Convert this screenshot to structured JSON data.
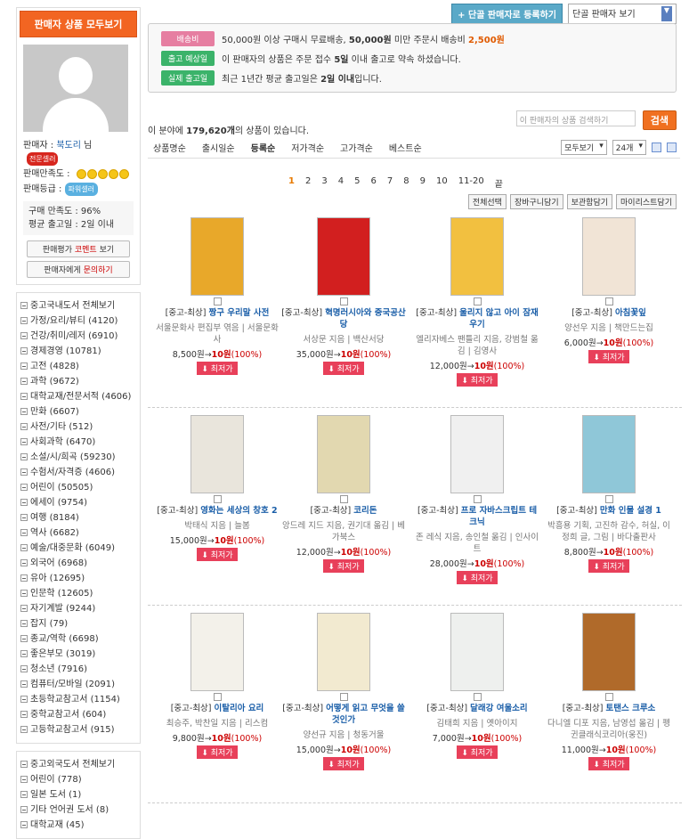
{
  "sidebar": {
    "header": "판매자 상품 모두보기",
    "seller_label": "판매자 :",
    "seller_name": "북도리",
    "seller_suffix": "님",
    "seller_badge": "전문셀러",
    "satisfaction_label": "판매만족도 :",
    "grade_label": "판매등급 :",
    "grade_badge": "파워셀러",
    "buy_satisfaction": "구매 만족도 : 96%",
    "avg_ship": "평균 출고일 : 2일 이내",
    "btn_comment_a": "판매평가",
    "btn_comment_b": "코멘트",
    "btn_comment_c": "보기",
    "btn_inquiry_a": "판매자에게",
    "btn_inquiry_b": "문의하기",
    "domestic_title": "중고국내도서 전체보기",
    "domestic": [
      "가정/요리/뷰티 (4120)",
      "건강/취미/레저 (6910)",
      "경제경영 (10781)",
      "고전 (4828)",
      "과학 (9672)",
      "대학교재/전문서적 (4606)",
      "만화 (6607)",
      "사전/기타 (512)",
      "사회과학 (6470)",
      "소설/시/희곡 (59230)",
      "수험서/자격증 (4606)",
      "어린이 (50505)",
      "에세이 (9754)",
      "여행 (8184)",
      "역사 (6682)",
      "예술/대중문화 (6049)",
      "외국어 (6968)",
      "유아 (12695)",
      "인문학 (12605)",
      "자기계발 (9244)",
      "잡지 (79)",
      "종교/역학 (6698)",
      "좋은부모 (3019)",
      "청소년 (7916)",
      "컴퓨터/모바일 (2091)",
      "초등학교참고서 (1154)",
      "중학교참고서 (604)",
      "고등학교참고서 (915)"
    ],
    "foreign_title": "중고외국도서 전체보기",
    "foreign": [
      "어린이 (778)",
      "일본 도서 (1)",
      "기타 언어권 도서 (8)",
      "대학교재 (45)"
    ]
  },
  "top": {
    "register_btn": "+ 단골 판매자로 등록하기",
    "seller_view": "단골 판매자 보기"
  },
  "info": {
    "tag1": "배송비",
    "line1a": "50,000원 이상 구매시 무료배송,",
    "line1b": "50,000원",
    "line1c": "미만 주문시 배송비",
    "line1d": "2,500원",
    "tag2": "출고 예상일",
    "line2a": "이 판매자의 상품은 주문 접수",
    "line2b": "5일",
    "line2c": "이내 출고로 약속 하셨습니다.",
    "tag3": "실제 출고일",
    "line3a": "최근 1년간 평균 출고일은",
    "line3b": "2일 이내",
    "line3c": "입니다."
  },
  "count": {
    "pre": "이 분야에",
    "num": "179,620개",
    "post": "의 상품이 있습니다."
  },
  "search": {
    "placeholder": "이 판매자의 상품 검색하기",
    "button": "검색"
  },
  "sort": {
    "items": [
      "상품명순",
      "출시일순",
      "등록순",
      "저가격순",
      "고가격순",
      "베스트순"
    ],
    "select1": "모두보기",
    "select2": "24개"
  },
  "pager": {
    "pages": [
      "1",
      "2",
      "3",
      "4",
      "5",
      "6",
      "7",
      "8",
      "9",
      "10",
      "11-20",
      "끝"
    ]
  },
  "actions": [
    "전체선택",
    "장바구니담기",
    "보관함담기",
    "마이리스트담기"
  ],
  "products": [
    {
      "prefix": "[중고-최상]",
      "title": "짱구 우리말 사전",
      "author": "서울문화사 편집부 엮음 | 서울문화사",
      "orig": "8,500원",
      "low": "10원",
      "pct": "(100%)",
      "btn": "최저가",
      "color": "#e8a82a"
    },
    {
      "prefix": "[중고-최상]",
      "title": "혁명러시아와 중국공산당",
      "author": "서상문 지음 | 백산서당",
      "orig": "35,000원",
      "low": "10원",
      "pct": "(100%)",
      "btn": "최저가",
      "color": "#d21f1f"
    },
    {
      "prefix": "[중고-최상]",
      "title": "울리지 않고 아이 잠재우기",
      "author": "엘리자베스 팬틀리 지음, 강범철 옮김 | 김영사",
      "orig": "12,000원",
      "low": "10원",
      "pct": "(100%)",
      "btn": "최저가",
      "color": "#f2c040"
    },
    {
      "prefix": "[중고-최상]",
      "title": "아침꽃잎",
      "author": "양선우 지음 | 책만드는집",
      "orig": "6,000원",
      "low": "10원",
      "pct": "(100%)",
      "btn": "최저가",
      "color": "#f1e4d6"
    },
    {
      "prefix": "[중고-최상]",
      "title": "영화는 세상의 창호 2",
      "author": "박태식 지음 | 늘봄",
      "orig": "15,000원",
      "low": "10원",
      "pct": "(100%)",
      "btn": "최저가",
      "color": "#e9e5dc"
    },
    {
      "prefix": "[중고-최상]",
      "title": "코리돈",
      "author": "앙드레 지드 지음, 권기대 옮김 | 베가북스",
      "orig": "12,000원",
      "low": "10원",
      "pct": "(100%)",
      "btn": "최저가",
      "color": "#e2d8b0"
    },
    {
      "prefix": "[중고-최상]",
      "title": "프로 자바스크립트 테크닉",
      "author": "존 레식 지음, 송인철 옮김 | 인사이트",
      "orig": "28,000원",
      "low": "10원",
      "pct": "(100%)",
      "btn": "최저가",
      "color": "#f0f0f0"
    },
    {
      "prefix": "[중고-최상]",
      "title": "만화 인물 설경 1",
      "author": "박흥용 기획, 고진하 감수, 허실, 이정희 글, 그림 | 바다출판사",
      "orig": "8,800원",
      "low": "10원",
      "pct": "(100%)",
      "btn": "최저가",
      "color": "#8fc7d8"
    },
    {
      "prefix": "[중고-최상]",
      "title": "이탈리아 요리",
      "author": "최승주, 박찬일 지음 | 리스컴",
      "orig": "9,800원",
      "low": "10원",
      "pct": "(100%)",
      "btn": "최저가",
      "color": "#f3f1ea"
    },
    {
      "prefix": "[중고-최상]",
      "title": "어떻게 읽고 무엇을 쓸 것인가",
      "author": "양선규 지음 | 청동거울",
      "orig": "15,000원",
      "low": "10원",
      "pct": "(100%)",
      "btn": "최저가",
      "color": "#f2ead0"
    },
    {
      "prefix": "[중고-최상]",
      "title": "달래강 여울소리",
      "author": "김태희 지음 | 옛아이지",
      "orig": "7,000원",
      "low": "10원",
      "pct": "(100%)",
      "btn": "최저가",
      "color": "#eef0ee"
    },
    {
      "prefix": "[중고-최상]",
      "title": "토탠스 크루소",
      "author": "다니엘 디포 지음, 남영섭 옮김 | 펭귄클래식코리아(웅진)",
      "orig": "11,000원",
      "low": "10원",
      "pct": "(100%)",
      "btn": "최저가",
      "color": "#b06a2a"
    }
  ]
}
